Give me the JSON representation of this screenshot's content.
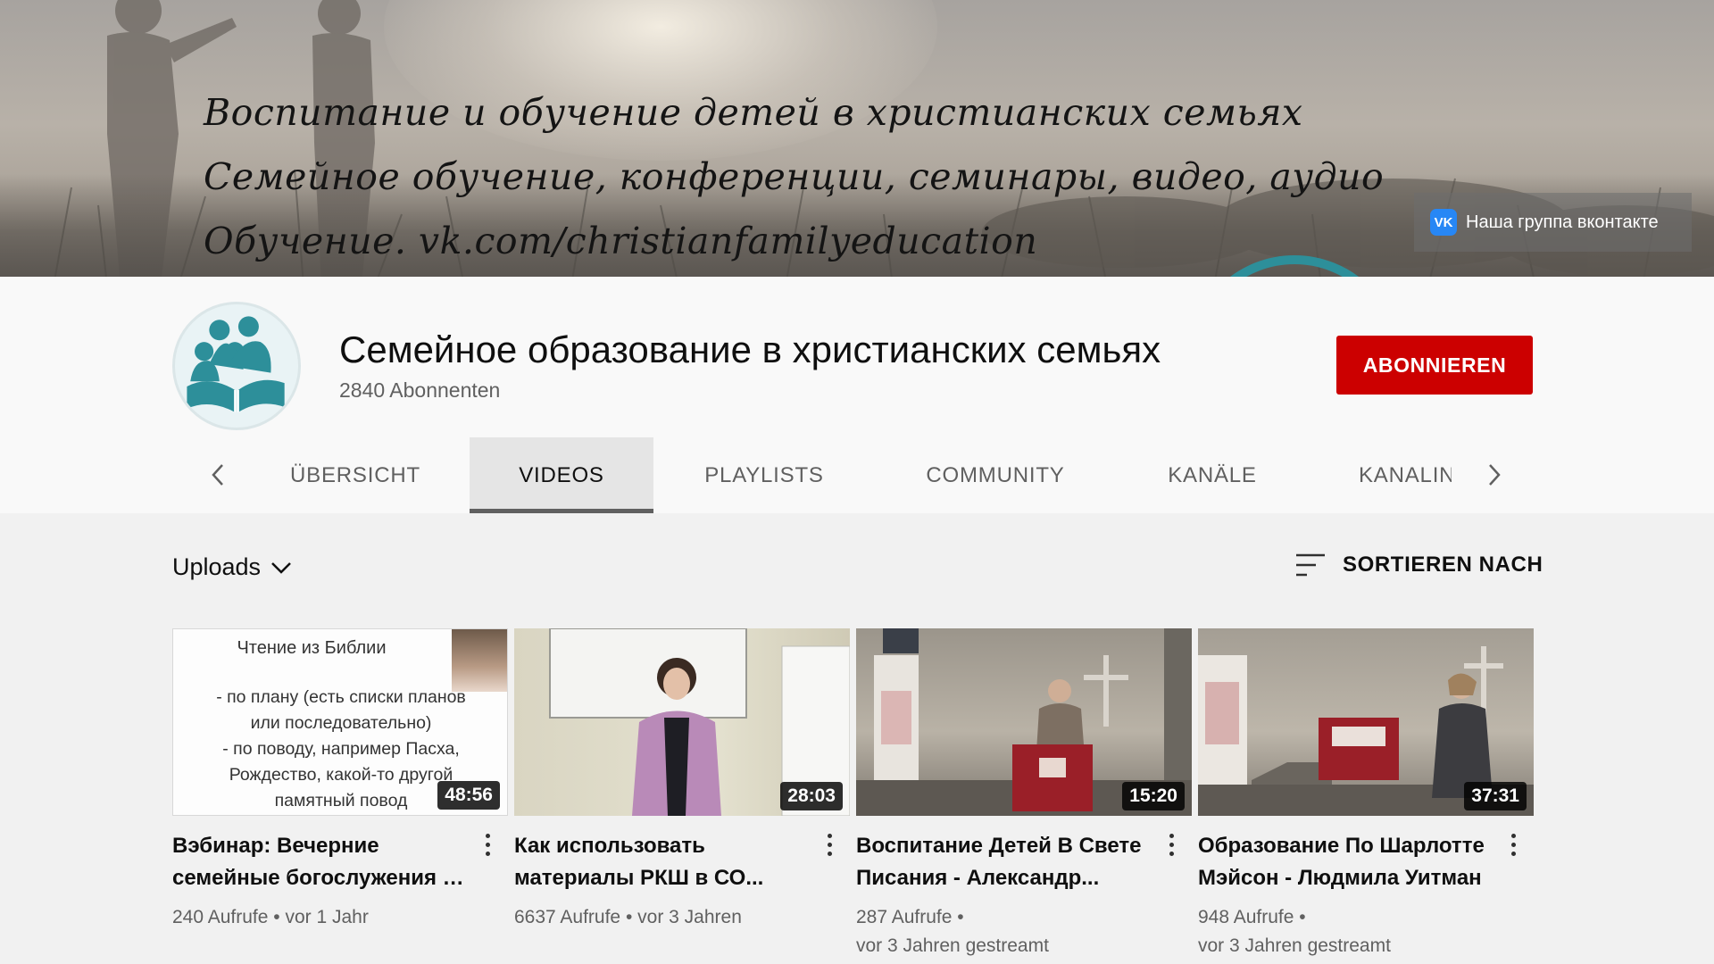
{
  "banner": {
    "lines": [
      "Воспитание и обучение детей в христианских семьях",
      "Семейное обучение, конференции, семинары, видео, аудио",
      "Обучение. vk.com/christianfamilyeducation"
    ],
    "vk_link_label": "Наша группа вконтакте",
    "vk_icon": "vk-icon"
  },
  "channel": {
    "title": "Семейное образование в христианских семьях",
    "subscribers": "2840 Abonnenten",
    "subscribe_label": "ABONNIEREN",
    "avatar_icon": "family-book-logo"
  },
  "tabs": [
    {
      "label": "ÜBERSICHT",
      "active": false
    },
    {
      "label": "VIDEOS",
      "active": true
    },
    {
      "label": "PLAYLISTS",
      "active": false
    },
    {
      "label": "COMMUNITY",
      "active": false
    },
    {
      "label": "KANÄLE",
      "active": false
    },
    {
      "label": "KANALINFO",
      "active": false
    }
  ],
  "filters": {
    "uploads_label": "Uploads",
    "sort_label": "SORTIEREN NACH"
  },
  "videos": [
    {
      "title": "Вэбинар: Вечерние семейные богослужения - ...",
      "duration": "48:56",
      "views": "240 Aufrufe",
      "age": "vor 1 Jahr",
      "thumb_heading": "Чтение из Библии",
      "thumb_lines": [
        "- по плану (есть списки планов",
        "или последовательно)",
        "- по поводу, например Пасха,",
        "Рождество, какой-то другой",
        "памятный повод"
      ]
    },
    {
      "title": "Как использовать материалы РКШ в СО...",
      "duration": "28:03",
      "views": "6637 Aufrufe",
      "age": "vor 3 Jahren"
    },
    {
      "title": "Воспитание Детей В Свете Писания - Александр...",
      "duration": "15:20",
      "views": "287 Aufrufe",
      "age": "vor 3 Jahren gestreamt"
    },
    {
      "title": "Образование По Шарлотте Мэйсон - Людмила Уитман",
      "duration": "37:31",
      "views": "948 Aufrufe",
      "age": "vor 3 Jahren gestreamt"
    }
  ],
  "colors": {
    "subscribe": "#cc0000",
    "vk": "#2787f5",
    "logo_teal": "#2d8f9a"
  }
}
